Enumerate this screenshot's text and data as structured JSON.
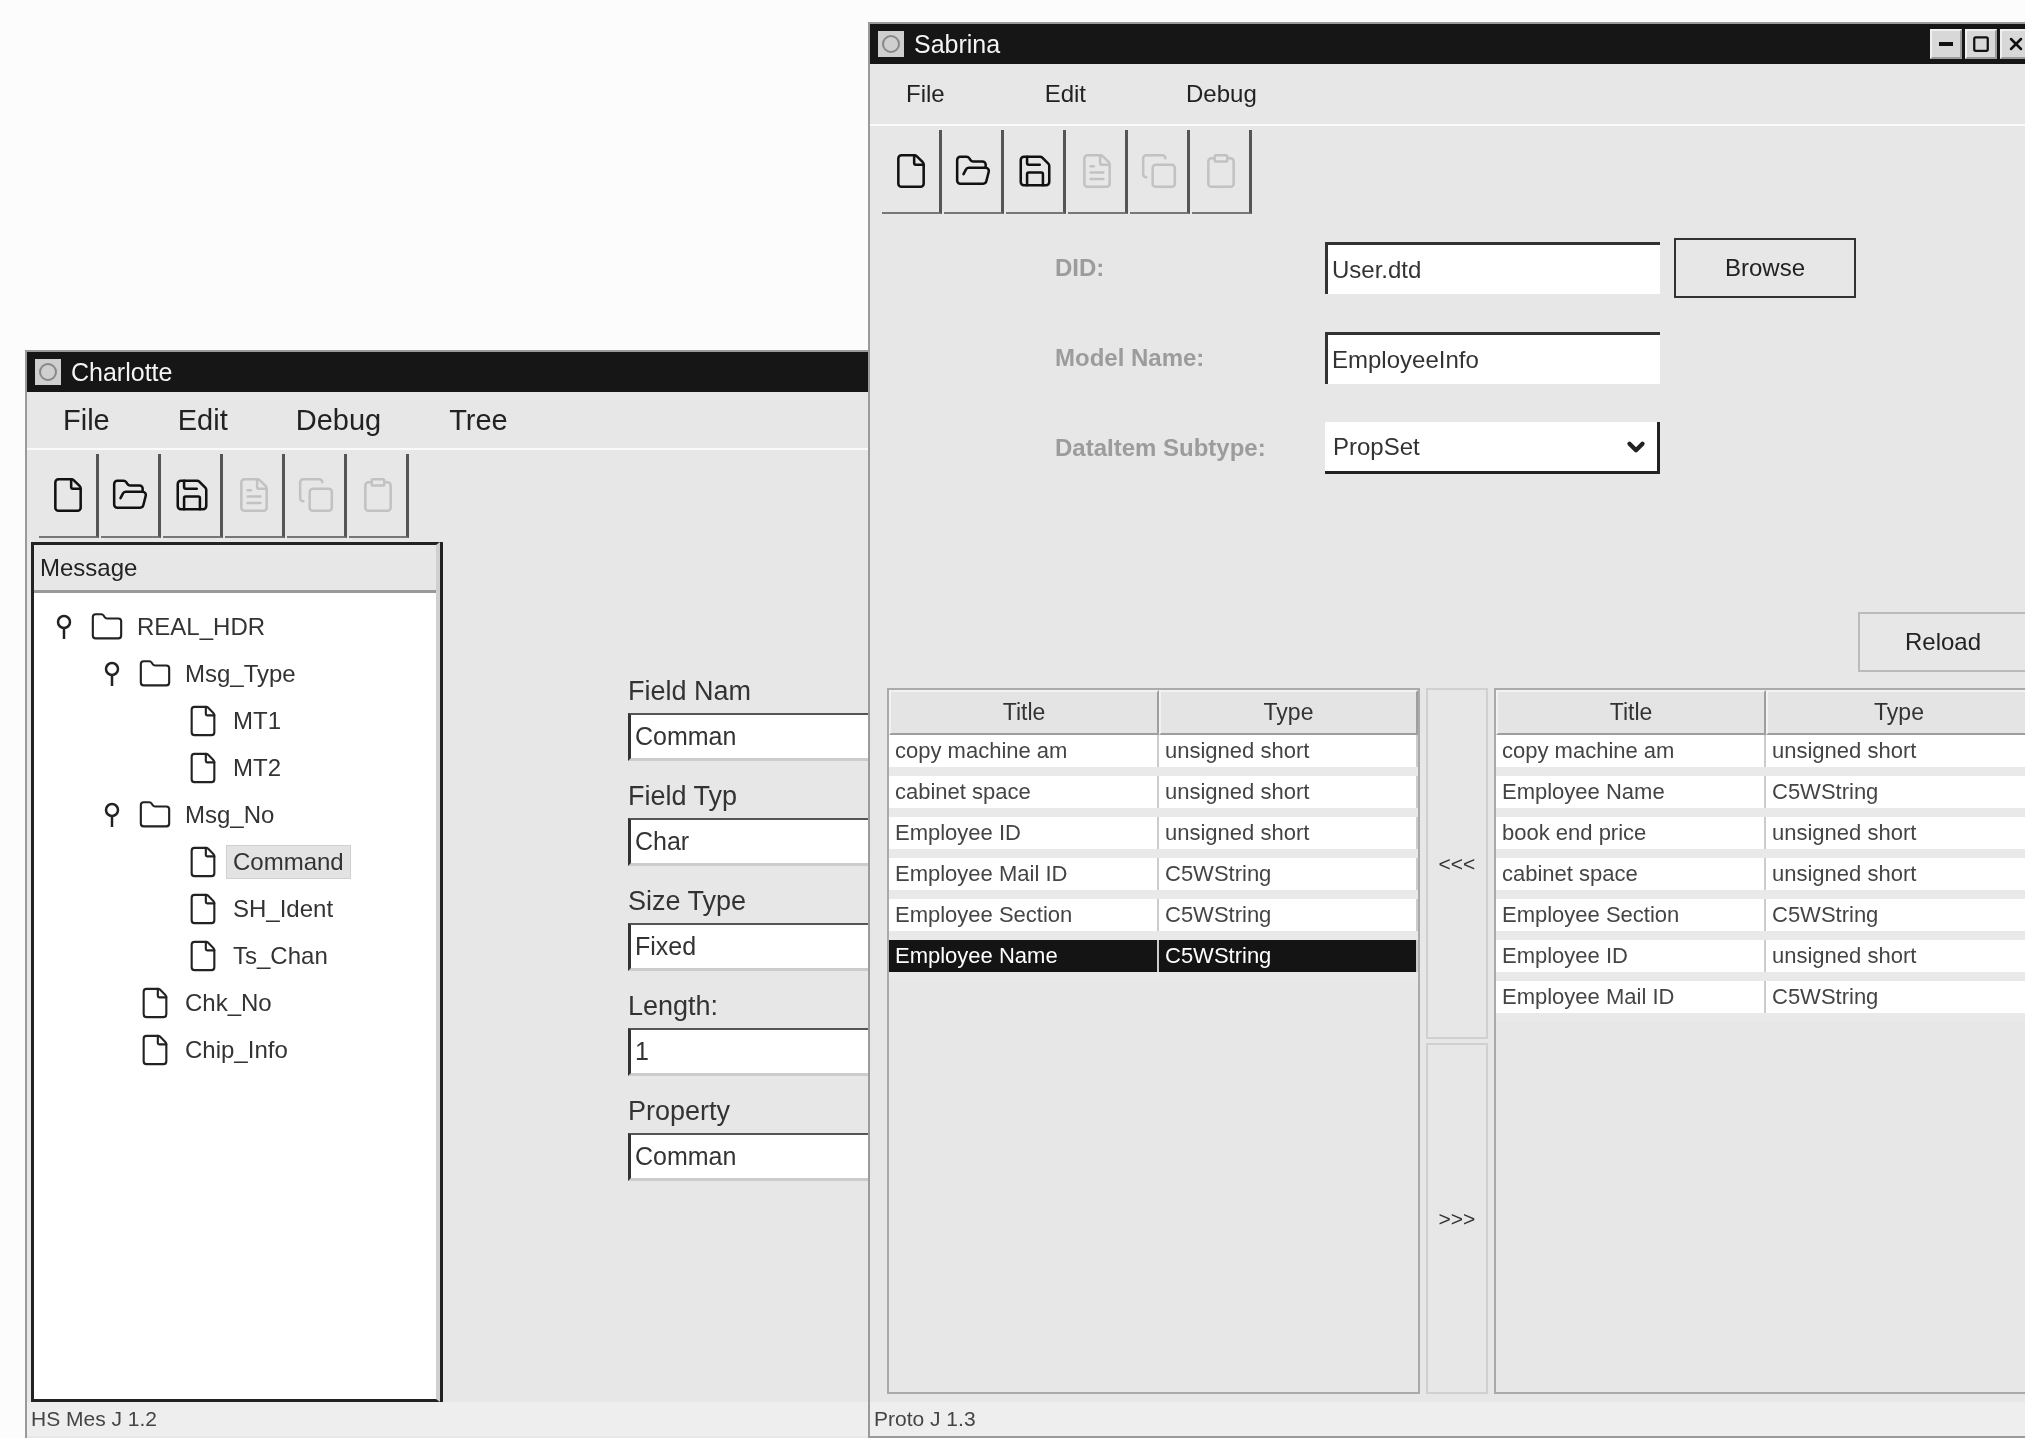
{
  "back_window": {
    "title": "Charlotte",
    "menu": [
      "File",
      "Edit",
      "Debug",
      "Tree"
    ],
    "toolbar": [
      {
        "disabled": false
      },
      {
        "disabled": false
      },
      {
        "disabled": false
      },
      {
        "disabled": true
      },
      {
        "disabled": true
      },
      {
        "disabled": true
      }
    ],
    "tree": {
      "header": "Message",
      "items": [
        {
          "label": "REAL_HDR",
          "kind": "folder",
          "expanded": true,
          "selected": false,
          "children": [
            {
              "label": "Msg_Type",
              "kind": "folder",
              "expanded": true,
              "selected": false,
              "children": [
                {
                  "label": "MT1",
                  "kind": "leaf",
                  "selected": false
                },
                {
                  "label": "MT2",
                  "kind": "leaf",
                  "selected": false
                }
              ]
            },
            {
              "label": "Msg_No",
              "kind": "folder",
              "expanded": true,
              "selected": false,
              "children": [
                {
                  "label": "Command",
                  "kind": "leaf",
                  "selected": true
                },
                {
                  "label": "SH_Ident",
                  "kind": "leaf",
                  "selected": false
                },
                {
                  "label": "Ts_Chan",
                  "kind": "leaf",
                  "selected": false
                }
              ]
            },
            {
              "label": "Chk_No",
              "kind": "leaf",
              "selected": false
            },
            {
              "label": "Chip_Info",
              "kind": "leaf",
              "selected": false
            }
          ]
        }
      ]
    },
    "fields": [
      {
        "label": "Field Nam",
        "value": "Comman"
      },
      {
        "label": "Field Typ",
        "value": "Char"
      },
      {
        "label": "Size Type",
        "value": "Fixed"
      },
      {
        "label": "Length:",
        "value": "1"
      },
      {
        "label": "Property",
        "value": "Comman"
      }
    ],
    "status_bar": "HS Mes J 1.2"
  },
  "front_window": {
    "title": "Sabrina",
    "menu": [
      "File",
      "Edit",
      "Debug"
    ],
    "toolbar": [
      {
        "disabled": false
      },
      {
        "disabled": false
      },
      {
        "disabled": false
      },
      {
        "disabled": true
      },
      {
        "disabled": true
      },
      {
        "disabled": true
      }
    ],
    "form": [
      {
        "kind": "text",
        "label": "DID:",
        "value": "User.dtd"
      },
      {
        "kind": "text",
        "label": "Model Name:",
        "value": "EmployeeInfo"
      },
      {
        "kind": "select",
        "label": "DataItem Subtype:",
        "value": "PropSet"
      }
    ],
    "browse_button": "Browse",
    "reload_button": "Reload",
    "left_table": {
      "columns": [
        "Title",
        "Type"
      ],
      "rows": [
        {
          "cells": [
            "copy machine am",
            "unsigned short"
          ],
          "selected": false
        },
        {
          "cells": [
            "cabinet space",
            "unsigned short"
          ],
          "selected": false
        },
        {
          "cells": [
            "Employee ID",
            "unsigned short"
          ],
          "selected": false
        },
        {
          "cells": [
            "Employee Mail ID",
            "C5WString"
          ],
          "selected": false
        },
        {
          "cells": [
            "Employee Section",
            "C5WString"
          ],
          "selected": false
        },
        {
          "cells": [
            "Employee Name",
            "C5WString"
          ],
          "selected": true
        }
      ]
    },
    "move_left_button": "<<<",
    "move_right_button": ">>>",
    "right_table": {
      "columns": [
        "Title",
        "Type"
      ],
      "rows": [
        {
          "cells": [
            "copy machine am",
            "unsigned short"
          ],
          "selected": false
        },
        {
          "cells": [
            "Employee Name",
            "C5WString"
          ],
          "selected": false
        },
        {
          "cells": [
            "book end price",
            "unsigned short"
          ],
          "selected": false
        },
        {
          "cells": [
            "cabinet space",
            "unsigned short"
          ],
          "selected": false
        },
        {
          "cells": [
            "Employee Section",
            "C5WString"
          ],
          "selected": false
        },
        {
          "cells": [
            "Employee ID",
            "unsigned short"
          ],
          "selected": false
        },
        {
          "cells": [
            "Employee Mail ID",
            "C5WString"
          ],
          "selected": false
        }
      ]
    },
    "status_bar": "Proto J 1.3"
  }
}
